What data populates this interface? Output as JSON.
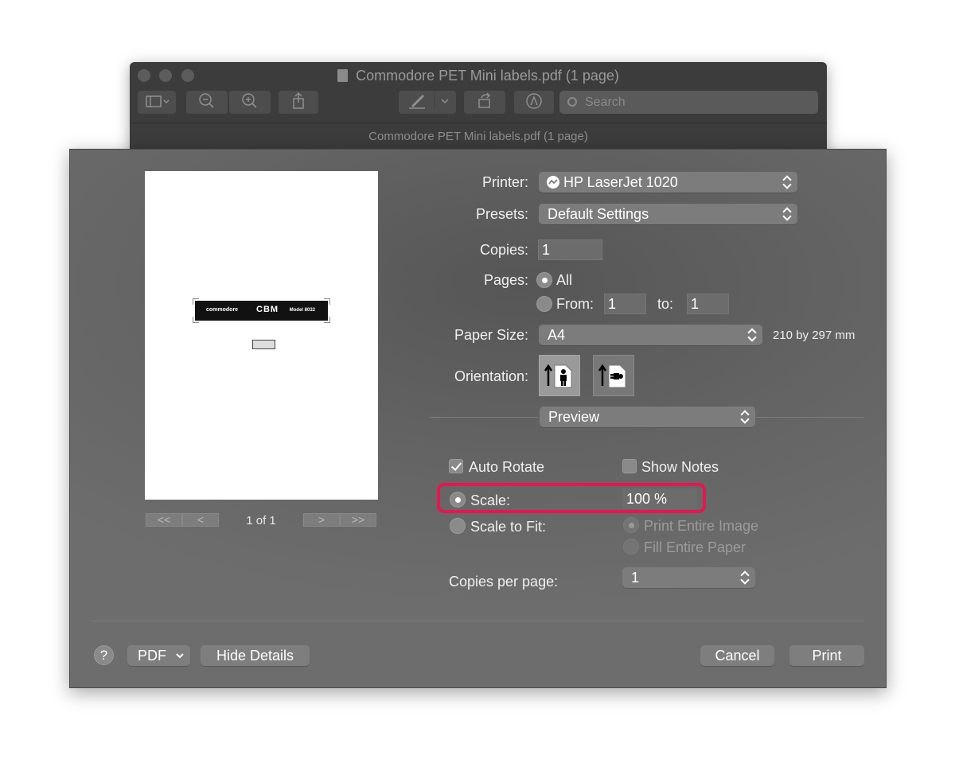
{
  "window": {
    "title": "Commodore PET Mini labels.pdf (1 page)",
    "subtitle": "Commodore PET Mini labels.pdf (1 page)",
    "search_placeholder": "Search"
  },
  "preview": {
    "label_brand": "commodore",
    "label_center": "CBM",
    "label_model": "Model 8032",
    "page_indicator": "1 of 1",
    "nav_first": "<<",
    "nav_prev": "<",
    "nav_next": ">",
    "nav_last": ">>"
  },
  "form": {
    "printer_label": "Printer:",
    "printer_value": "HP LaserJet 1020",
    "presets_label": "Presets:",
    "presets_value": "Default Settings",
    "copies_label": "Copies:",
    "copies_value": "1",
    "pages_label": "Pages:",
    "pages_all": "All",
    "pages_from_label": "From:",
    "pages_from_value": "1",
    "pages_to_label": "to:",
    "pages_to_value": "1",
    "paper_size_label": "Paper Size:",
    "paper_size_value": "A4",
    "paper_size_dims": "210 by 297 mm",
    "orientation_label": "Orientation:",
    "section_value": "Preview",
    "auto_rotate": "Auto Rotate",
    "auto_rotate_checked": true,
    "show_notes": "Show Notes",
    "show_notes_checked": false,
    "scale_label": "Scale:",
    "scale_value": "100 %",
    "scale_to_fit": "Scale to Fit:",
    "print_entire_image": "Print Entire Image",
    "fill_entire_paper": "Fill Entire Paper",
    "copies_per_page_label": "Copies per page:",
    "copies_per_page_value": "1"
  },
  "footer": {
    "help": "?",
    "pdf": "PDF",
    "hide_details": "Hide Details",
    "cancel": "Cancel",
    "print": "Print"
  },
  "colors": {
    "highlight": "#e5174f",
    "sheet_bg": "#646464"
  }
}
